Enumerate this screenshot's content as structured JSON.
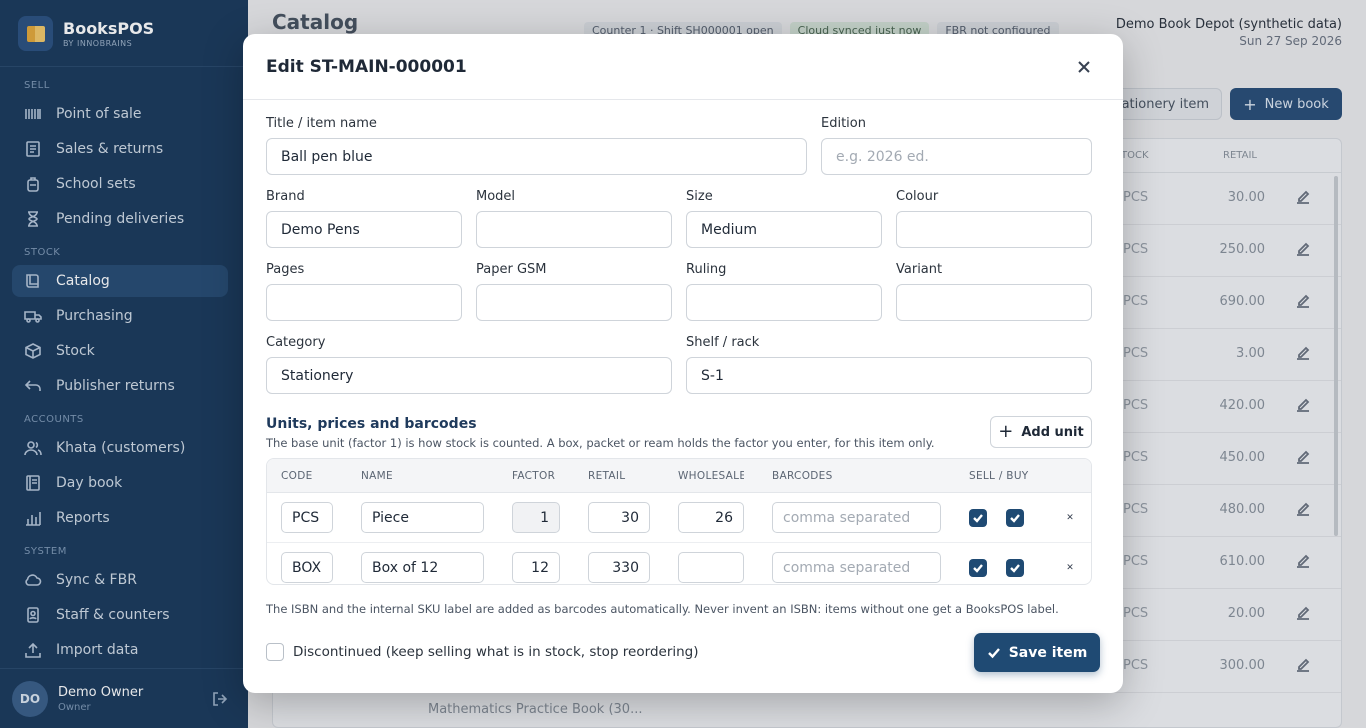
{
  "app": {
    "name": "BooksPOS",
    "sub": "BY INNOBRAINS"
  },
  "sidebar": {
    "sections": {
      "sell": "SELL",
      "stock": "STOCK",
      "accounts": "ACCOUNTS",
      "system": "SYSTEM"
    },
    "items": [
      {
        "label": "Point of sale",
        "icon": "barcode-icon"
      },
      {
        "label": "Sales & returns",
        "icon": "receipt-icon"
      },
      {
        "label": "School sets",
        "icon": "backpack-icon"
      },
      {
        "label": "Pending deliveries",
        "icon": "hourglass-icon"
      },
      {
        "label": "Catalog",
        "icon": "book-icon",
        "active": true
      },
      {
        "label": "Purchasing",
        "icon": "truck-icon"
      },
      {
        "label": "Stock",
        "icon": "box-icon"
      },
      {
        "label": "Publisher returns",
        "icon": "return-icon"
      },
      {
        "label": "Khata (customers)",
        "icon": "users-icon"
      },
      {
        "label": "Day book",
        "icon": "notebook-icon"
      },
      {
        "label": "Reports",
        "icon": "bar-chart-icon"
      },
      {
        "label": "Sync & FBR",
        "icon": "cloud-icon"
      },
      {
        "label": "Staff & counters",
        "icon": "id-badge-icon"
      },
      {
        "label": "Import data",
        "icon": "upload-icon"
      }
    ],
    "user": {
      "initials": "DO",
      "name": "Demo Owner",
      "role": "Owner"
    }
  },
  "header": {
    "title": "Catalog",
    "badges": [
      "Counter 1 · Shift SH000001 open",
      "Cloud synced just now",
      "FBR not configured"
    ],
    "shop": "Demo Book Depot (synthetic data)",
    "date": "Sun 27 Sep 2026",
    "stationery_button": "tationery item",
    "new_book_button": "New book"
  },
  "background_table": {
    "col_stock": "TOCK",
    "col_retail": "RETAIL",
    "rows": [
      {
        "unit": "PCS",
        "retail": "30.00"
      },
      {
        "unit": "PCS",
        "retail": "250.00"
      },
      {
        "unit": "PCS",
        "retail": "690.00"
      },
      {
        "unit": "PCS",
        "retail": "3.00"
      },
      {
        "unit": "PCS",
        "retail": "420.00"
      },
      {
        "unit": "PCS",
        "retail": "450.00"
      },
      {
        "unit": "PCS",
        "retail": "480.00"
      },
      {
        "unit": "PCS",
        "retail": "610.00"
      },
      {
        "unit": "PCS",
        "retail": "20.00"
      },
      {
        "unit": "PCS",
        "retail": "300.00"
      }
    ],
    "bottom_text": "Mathematics Practice Book (30..."
  },
  "modal": {
    "title": "Edit ST-MAIN-000001",
    "fields": {
      "title": {
        "label": "Title / item name",
        "value": "Ball pen blue",
        "placeholder": ""
      },
      "edition": {
        "label": "Edition",
        "value": "",
        "placeholder": "e.g. 2026 ed."
      },
      "brand": {
        "label": "Brand",
        "value": "Demo Pens"
      },
      "model": {
        "label": "Model",
        "value": ""
      },
      "size": {
        "label": "Size",
        "value": "Medium"
      },
      "colour": {
        "label": "Colour",
        "value": ""
      },
      "pages": {
        "label": "Pages",
        "value": ""
      },
      "paper_gsm": {
        "label": "Paper GSM",
        "value": ""
      },
      "ruling": {
        "label": "Ruling",
        "value": ""
      },
      "variant": {
        "label": "Variant",
        "value": ""
      },
      "category": {
        "label": "Category",
        "value": "Stationery"
      },
      "shelf": {
        "label": "Shelf / rack",
        "value": "S-1"
      }
    },
    "units": {
      "title": "Units, prices and barcodes",
      "description": "The base unit (factor 1) is how stock is counted. A box, packet or ream holds the factor you enter, for this item only.",
      "add_button": "Add unit",
      "columns": [
        "CODE",
        "NAME",
        "FACTOR",
        "RETAIL",
        "WHOLESALE",
        "BARCODES",
        "SELL / BUY"
      ],
      "barcode_placeholder": "comma separated",
      "rows": [
        {
          "code": "PCS",
          "name": "Piece",
          "factor": "1",
          "retail": "30",
          "wholesale": "26",
          "barcodes": "",
          "sell": true,
          "buy": true
        },
        {
          "code": "BOX",
          "name": "Box of 12",
          "factor": "12",
          "retail": "330",
          "wholesale": "",
          "barcodes": "",
          "sell": true,
          "buy": true
        }
      ]
    },
    "barcode_note": "The ISBN and the internal SKU label are added as barcodes automatically. Never invent an ISBN: items without one get a BooksPOS label.",
    "discontinued_label": "Discontinued (keep selling what is in stock, stop reordering)",
    "save_button": "Save item"
  }
}
